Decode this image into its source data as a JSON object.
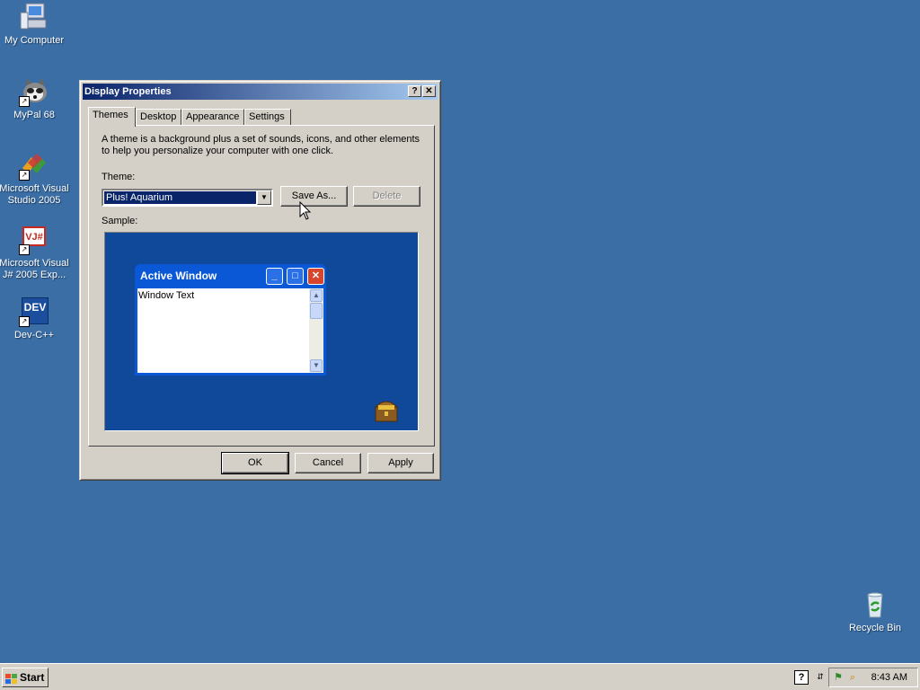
{
  "desktop": {
    "icons": [
      {
        "label": "My Computer",
        "icon": "my-computer-icon"
      },
      {
        "label": "MyPal 68",
        "icon": "raccoon-icon"
      },
      {
        "label": "Microsoft Visual Studio 2005",
        "icon": "visual-studio-icon"
      },
      {
        "label": "Microsoft Visual J# 2005 Exp...",
        "icon": "vjsharp-icon",
        "glyph": "VJ#"
      },
      {
        "label": "Dev-C++",
        "icon": "devcpp-icon",
        "glyph": "DEV"
      },
      {
        "label": "Recycle Bin",
        "icon": "recycle-bin-icon"
      }
    ],
    "background": "#3a6ea5"
  },
  "dialog": {
    "title": "Display Properties",
    "help_glyph": "?",
    "close_glyph": "✕",
    "tabs": [
      "Themes",
      "Desktop",
      "Appearance",
      "Settings"
    ],
    "active_tab": "Themes",
    "description": "A theme is a background plus a set of sounds, icons, and other elements to help you personalize your computer with one click.",
    "theme_label": "Theme:",
    "theme_value": "Plus! Aquarium",
    "save_as_label": "Save As...",
    "delete_label": "Delete",
    "sample_label": "Sample:",
    "sample": {
      "window_title": "Active Window",
      "window_text": "Window Text"
    },
    "ok_label": "OK",
    "cancel_label": "Cancel",
    "apply_label": "Apply"
  },
  "taskbar": {
    "start_label": "Start",
    "clock": "8:43 AM"
  }
}
